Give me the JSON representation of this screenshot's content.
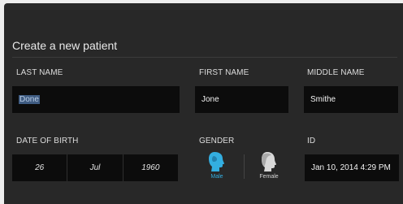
{
  "form": {
    "title": "Create a new patient",
    "last_name": {
      "label": "LAST NAME",
      "value": "Done"
    },
    "first_name": {
      "label": "FIRST NAME",
      "value": "Jone"
    },
    "middle_name": {
      "label": "MIDDLE NAME",
      "value": "Smithe"
    },
    "date_of_birth": {
      "label": "DATE OF BIRTH",
      "day": "26",
      "month": "Jul",
      "year": "1960"
    },
    "gender": {
      "label": "GENDER",
      "options": [
        {
          "label": "Male",
          "icon": "male-head-icon",
          "selected": true
        },
        {
          "label": "Female",
          "icon": "female-head-icon",
          "selected": false
        }
      ]
    },
    "id": {
      "label": "ID",
      "value": "Jan 10, 2014 4:29 PM"
    }
  },
  "colors": {
    "background": "#282828",
    "field": "#0c0c0c",
    "accent": "#33aee0",
    "selection": "#3f5c82"
  }
}
